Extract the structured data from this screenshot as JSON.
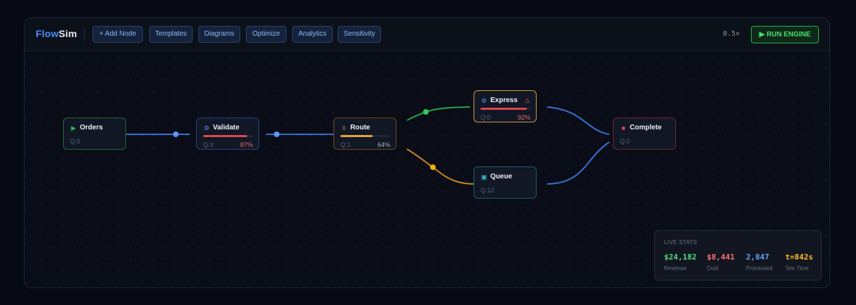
{
  "app": {
    "brand_a": "Flow",
    "brand_b": "Sim"
  },
  "toolbar": {
    "buttons": [
      "+ Add Node",
      "Templates",
      "Diagrams",
      "Optimize",
      "Analytics",
      "Sensitivity"
    ],
    "zoom": "0.5×",
    "run_label": "▶ RUN ENGINE"
  },
  "nodes": {
    "orders": {
      "title": "Orders",
      "icon": "play-icon",
      "queue": "Q:0"
    },
    "validate": {
      "title": "Validate",
      "icon": "gear-icon",
      "queue": "Q:3",
      "utilization": "87%",
      "fill": 0.87
    },
    "route": {
      "title": "Route",
      "icon": "router-icon",
      "queue": "Q:1",
      "utilization": "64%",
      "fill": 0.64
    },
    "express": {
      "title": "Express",
      "icon": "gear-icon",
      "queue": "Q:0",
      "utilization": "92%",
      "fill": 0.92,
      "warning": "⚠"
    },
    "queue": {
      "title": "Queue",
      "icon": "queue-icon",
      "queue": "Q:12"
    },
    "complete": {
      "title": "Complete",
      "icon": "stop-icon",
      "queue": "Q:0"
    }
  },
  "colors": {
    "accent": "#4d8ef7",
    "green": "#2fb85a",
    "orange": "#e8a23a",
    "red": "#e0474c",
    "teal": "#1f5f6b"
  },
  "stats": {
    "header": "LIVE STATS",
    "items": [
      {
        "value": "$24,182",
        "label": "Revenue",
        "color": "#4ade80"
      },
      {
        "value": "$8,441",
        "label": "Cost",
        "color": "#f87171"
      },
      {
        "value": "2,847",
        "label": "Processed",
        "color": "#60a5fa"
      },
      {
        "value": "t=842s",
        "label": "Sim Time",
        "color": "#fbbf24"
      }
    ]
  }
}
